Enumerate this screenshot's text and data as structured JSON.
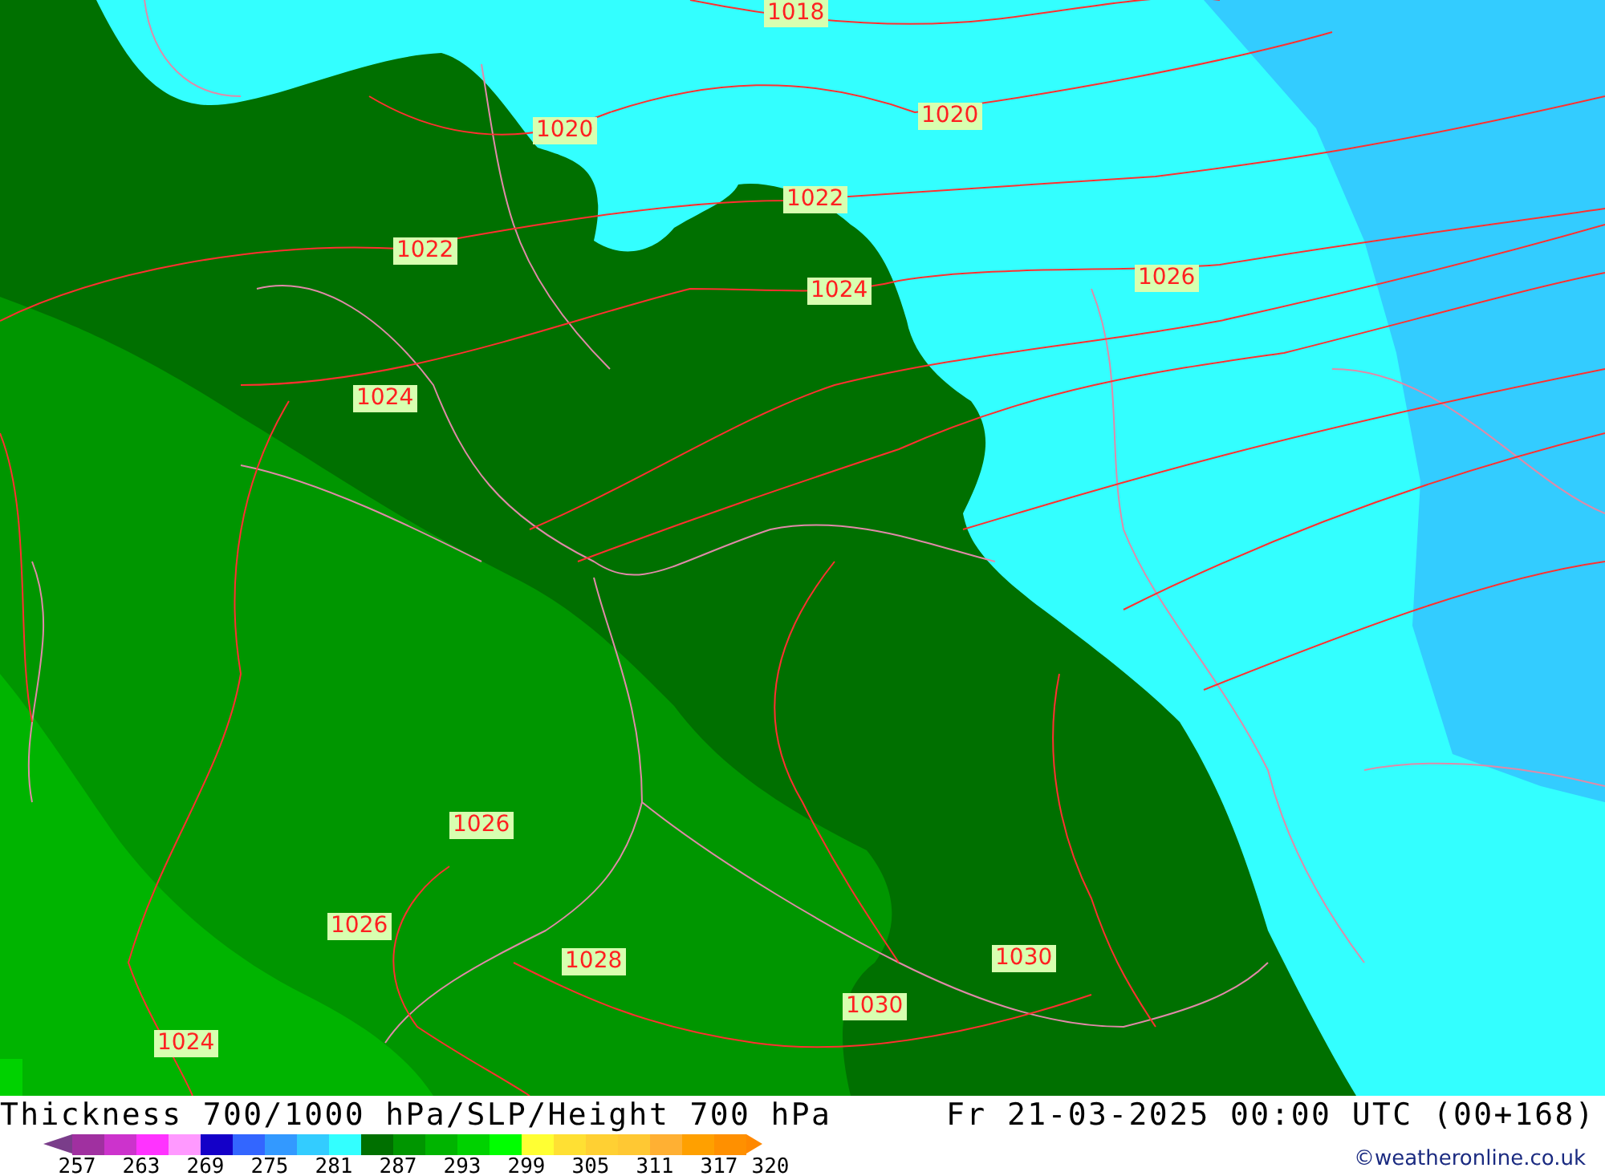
{
  "map": {
    "isobar_labels": [
      {
        "text": "1018"
      },
      {
        "text": "1020"
      },
      {
        "text": "1020"
      },
      {
        "text": "1022"
      },
      {
        "text": "1022"
      },
      {
        "text": "1024"
      },
      {
        "text": "1026"
      },
      {
        "text": "1024"
      },
      {
        "text": "1026"
      },
      {
        "text": "1026"
      },
      {
        "text": "1028"
      },
      {
        "text": "1030"
      },
      {
        "text": "1030"
      },
      {
        "text": "1024"
      }
    ]
  },
  "footer": {
    "title": "Thickness 700/1000 hPa/SLP/Height 700 hPa",
    "valid_time": "Fr 21-03-2025 00:00 UTC (00+168)",
    "copyright": "©weatheronline.co.uk",
    "legend": {
      "swatches": [
        {
          "color": "#a030a0"
        },
        {
          "color": "#cc33cc"
        },
        {
          "color": "#ff33ff"
        },
        {
          "color": "#ff99ff"
        },
        {
          "color": "#1400c8"
        },
        {
          "color": "#3366ff"
        },
        {
          "color": "#3399ff"
        },
        {
          "color": "#33ccff"
        },
        {
          "color": "#33ffff"
        },
        {
          "color": "#007000"
        },
        {
          "color": "#009600"
        },
        {
          "color": "#00b400"
        },
        {
          "color": "#00d200"
        },
        {
          "color": "#00ff00"
        },
        {
          "color": "#ffff33"
        },
        {
          "color": "#ffe033"
        },
        {
          "color": "#ffd033"
        },
        {
          "color": "#ffc833"
        },
        {
          "color": "#ffb033"
        },
        {
          "color": "#ffa000"
        },
        {
          "color": "#ff9000"
        }
      ],
      "ticks": [
        "257",
        "263",
        "269",
        "275",
        "281",
        "287",
        "293",
        "299",
        "305",
        "311",
        "317",
        "320"
      ]
    }
  }
}
